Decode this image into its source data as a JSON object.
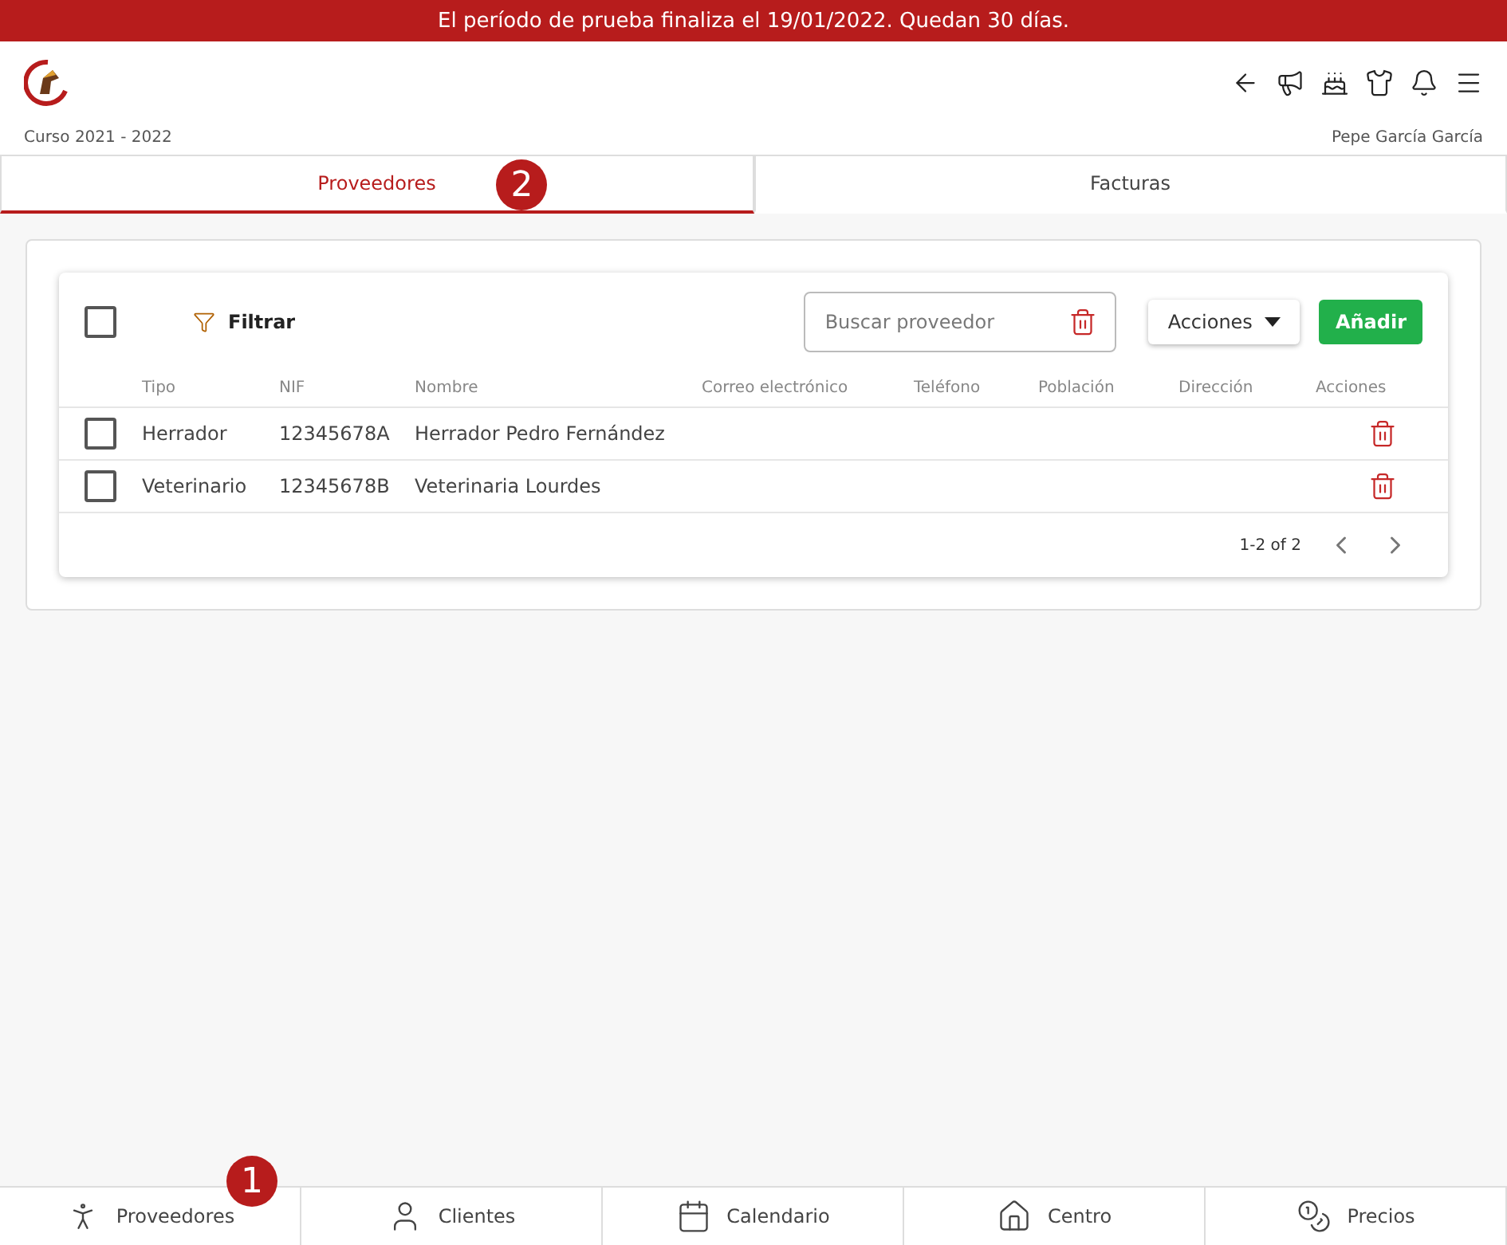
{
  "banner": "El período de prueba finaliza el 19/01/2022. Quedan 30 días.",
  "header": {
    "course": "Curso 2021 - 2022",
    "user": "Pepe García García"
  },
  "tabs": [
    {
      "label": "Proveedores",
      "selected": true,
      "callout": "2"
    },
    {
      "label": "Facturas",
      "selected": false
    }
  ],
  "toolbar": {
    "select_all_checked": false,
    "filter": "Filtrar",
    "search_placeholder": "Buscar proveedor",
    "actions": "Acciones",
    "add": "Añadir"
  },
  "table": {
    "columns": [
      "Tipo",
      "NIF",
      "Nombre",
      "Correo electrónico",
      "Teléfono",
      "Población",
      "Dirección",
      "Acciones"
    ],
    "rows": [
      {
        "checked": false,
        "cells": [
          "Herrador",
          "12345678A",
          "Herrador Pedro Fernández",
          "",
          "",
          "",
          "",
          ""
        ]
      },
      {
        "checked": false,
        "cells": [
          "Veterinario",
          "12345678B",
          "Veterinaria Lourdes",
          "",
          "",
          "",
          "",
          ""
        ]
      }
    ],
    "pagination": "1-2 of 2"
  },
  "bottom_nav": [
    {
      "label": "Proveedores",
      "callout": "1"
    },
    {
      "label": "Clientes"
    },
    {
      "label": "Calendario"
    },
    {
      "label": "Centro"
    },
    {
      "label": "Precios"
    }
  ]
}
